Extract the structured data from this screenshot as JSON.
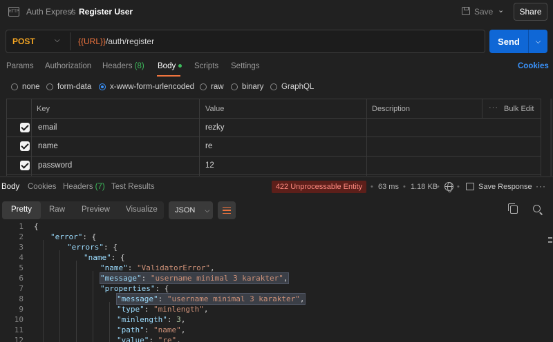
{
  "header": {
    "breadcrumb_parent": "Auth Express",
    "breadcrumb_sep": "/",
    "title": "Register User",
    "save_label": "Save",
    "share_label": "Share",
    "app_icon_text": "HTTP"
  },
  "request": {
    "method": "POST",
    "url_var": "{{URL}}",
    "url_path": "/auth/register",
    "send_label": "Send"
  },
  "request_tabs": {
    "params": "Params",
    "authorization": "Authorization",
    "headers": "Headers",
    "headers_count": "(8)",
    "body": "Body",
    "scripts": "Scripts",
    "settings": "Settings",
    "cookies": "Cookies"
  },
  "body_types": [
    "none",
    "form-data",
    "x-www-form-urlencoded",
    "raw",
    "binary",
    "GraphQL"
  ],
  "body_type_selected": "x-www-form-urlencoded",
  "params_table": {
    "headers": {
      "key": "Key",
      "value": "Value",
      "description": "Description",
      "bulk_edit": "Bulk Edit"
    },
    "rows": [
      {
        "checked": true,
        "key": "email",
        "value": "rezky",
        "description": ""
      },
      {
        "checked": true,
        "key": "name",
        "value": "re",
        "description": ""
      },
      {
        "checked": true,
        "key": "password",
        "value": "12",
        "description": ""
      }
    ]
  },
  "response_tabs": {
    "body": "Body",
    "cookies": "Cookies",
    "headers": "Headers",
    "headers_count": "(7)",
    "test_results": "Test Results"
  },
  "response_meta": {
    "status": "422 Unprocessable Entity",
    "time": "63 ms",
    "size": "1.18 KB",
    "save_response": "Save Response"
  },
  "viewer": {
    "modes": [
      "Pretty",
      "Raw",
      "Preview",
      "Visualize"
    ],
    "active_mode": "Pretty",
    "format": "JSON"
  },
  "code_lines": [
    {
      "n": "1",
      "indent": 0,
      "pre": "{",
      "key": "",
      "post": ""
    },
    {
      "n": "2",
      "indent": 1,
      "pre": "",
      "key": "\"error\"",
      "post": ": {"
    },
    {
      "n": "3",
      "indent": 2,
      "pre": "",
      "key": "\"errors\"",
      "post": ": {"
    },
    {
      "n": "4",
      "indent": 3,
      "pre": "",
      "key": "\"name\"",
      "post": ": {"
    },
    {
      "n": "5",
      "indent": 4,
      "pre": "",
      "key": "\"name\"",
      "post": ": ",
      "str": "\"ValidatorError\"",
      "tail": ","
    },
    {
      "n": "6",
      "indent": 4,
      "pre": "",
      "key": "\"message\"",
      "post": ": ",
      "str": "\"username minimal 3 karakter\"",
      "tail": ",",
      "highlight": true
    },
    {
      "n": "7",
      "indent": 4,
      "pre": "",
      "key": "\"properties\"",
      "post": ": {"
    },
    {
      "n": "8",
      "indent": 5,
      "pre": "",
      "key": "\"message\"",
      "post": ": ",
      "str": "\"username minimal 3 karakter\"",
      "tail": ",",
      "highlight": true
    },
    {
      "n": "9",
      "indent": 5,
      "pre": "",
      "key": "\"type\"",
      "post": ": ",
      "str": "\"minlength\"",
      "tail": ","
    },
    {
      "n": "10",
      "indent": 5,
      "pre": "",
      "key": "\"minlength\"",
      "post": ": ",
      "num": "3",
      "tail": ","
    },
    {
      "n": "11",
      "indent": 5,
      "pre": "",
      "key": "\"path\"",
      "post": ": ",
      "str": "\"name\"",
      "tail": ","
    },
    {
      "n": "12",
      "indent": 5,
      "pre": "",
      "key": "\"value\"",
      "post": ": ",
      "str": "\"re\"",
      "tail": ","
    }
  ],
  "colors": {
    "accent": "#f0743e",
    "send_blue": "#0f67d6",
    "link_blue": "#3a94ff",
    "success_green": "#3dbc5c",
    "error_bg": "#5c1f1a",
    "error_text": "#ff8a80"
  }
}
